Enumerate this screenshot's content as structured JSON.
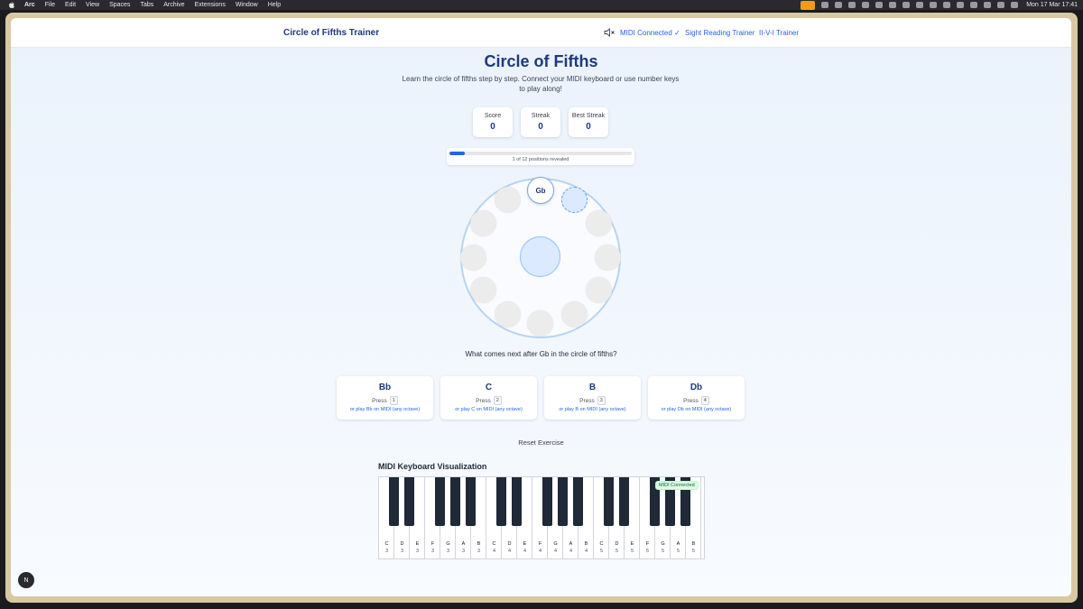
{
  "menubar": {
    "app": "Arc",
    "items": [
      "File",
      "Edit",
      "View",
      "Spaces",
      "Tabs",
      "Archive",
      "Extensions",
      "Window",
      "Help"
    ],
    "clock": "Mon 17 Mar  17:41"
  },
  "nav": {
    "brand": "Circle of Fifths Trainer",
    "midi_status": "MIDI Connected ✓",
    "links": [
      "Sight Reading Trainer",
      "II-V-I Trainer"
    ]
  },
  "hero": {
    "title": "Circle of Fifths",
    "subtitle": "Learn the circle of fifths step by step. Connect your MIDI keyboard or use number keys to play along!"
  },
  "stats": [
    {
      "label": "Score",
      "value": "0"
    },
    {
      "label": "Streak",
      "value": "0"
    },
    {
      "label": "Best Streak",
      "value": "0"
    }
  ],
  "progress": {
    "text": "1 of 12 positions revealed",
    "fraction": 0.083
  },
  "circle": {
    "revealed_note": "Gb"
  },
  "question": "What comes next after Gb in the circle of fifths?",
  "options": [
    {
      "note": "Bb",
      "press": "Press",
      "key": "1",
      "midi": "or play Bb on MIDI (any octave)"
    },
    {
      "note": "C",
      "press": "Press",
      "key": "2",
      "midi": "or play C on MIDI (any octave)"
    },
    {
      "note": "B",
      "press": "Press",
      "key": "3",
      "midi": "or play B on MIDI (any octave)"
    },
    {
      "note": "Db",
      "press": "Press",
      "key": "4",
      "midi": "or play Db on MIDI (any octave)"
    }
  ],
  "reset_label": "Reset Exercise",
  "keyboard": {
    "title": "MIDI Keyboard Visualization",
    "badge": "MIDI Connected",
    "white_keys": [
      {
        "name": "C",
        "octave": "3"
      },
      {
        "name": "D",
        "octave": "3"
      },
      {
        "name": "E",
        "octave": "3"
      },
      {
        "name": "F",
        "octave": "3"
      },
      {
        "name": "G",
        "octave": "3"
      },
      {
        "name": "A",
        "octave": "3"
      },
      {
        "name": "B",
        "octave": "3"
      },
      {
        "name": "C",
        "octave": "4"
      },
      {
        "name": "D",
        "octave": "4"
      },
      {
        "name": "E",
        "octave": "4"
      },
      {
        "name": "F",
        "octave": "4"
      },
      {
        "name": "G",
        "octave": "4"
      },
      {
        "name": "A",
        "octave": "4"
      },
      {
        "name": "B",
        "octave": "4"
      },
      {
        "name": "C",
        "octave": "5"
      },
      {
        "name": "D",
        "octave": "5"
      },
      {
        "name": "E",
        "octave": "5"
      },
      {
        "name": "F",
        "octave": "5"
      },
      {
        "name": "G",
        "octave": "5"
      },
      {
        "name": "A",
        "octave": "5"
      },
      {
        "name": "B",
        "octave": "5"
      }
    ]
  },
  "avatar_letter": "N",
  "colors": {
    "accent": "#2563eb",
    "heading": "#1e3a7a",
    "midi_ok": "#166534"
  }
}
